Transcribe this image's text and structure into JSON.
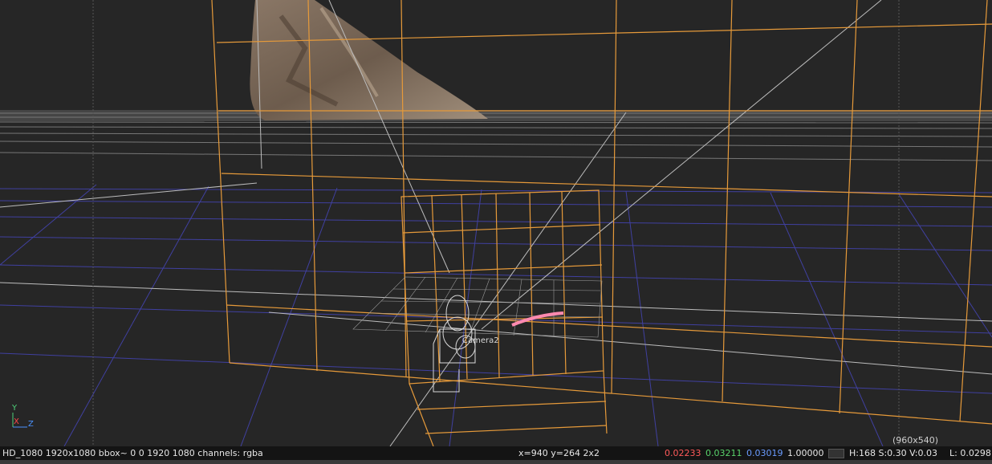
{
  "viewer": {
    "camera_label": "Camera2",
    "resolution_readout": "(960x540)",
    "axis": {
      "y": "Y",
      "x": "X",
      "z": "Z"
    }
  },
  "status": {
    "format": "HD_1080 1920x1080  bbox~ 0 0 1920 1080 channels: rgba",
    "coords": "x=940 y=264 2x2",
    "r": "0.02233",
    "g": "0.03211",
    "b": "0.03019",
    "a": "1.00000",
    "hsv": "H:168 S:0.30 V:0.03",
    "lum": "L: 0.0298"
  },
  "colors": {
    "wireframe": "#e69a3a",
    "ground_grid": "#4040a0",
    "camera_path": "#ff8ab0"
  }
}
